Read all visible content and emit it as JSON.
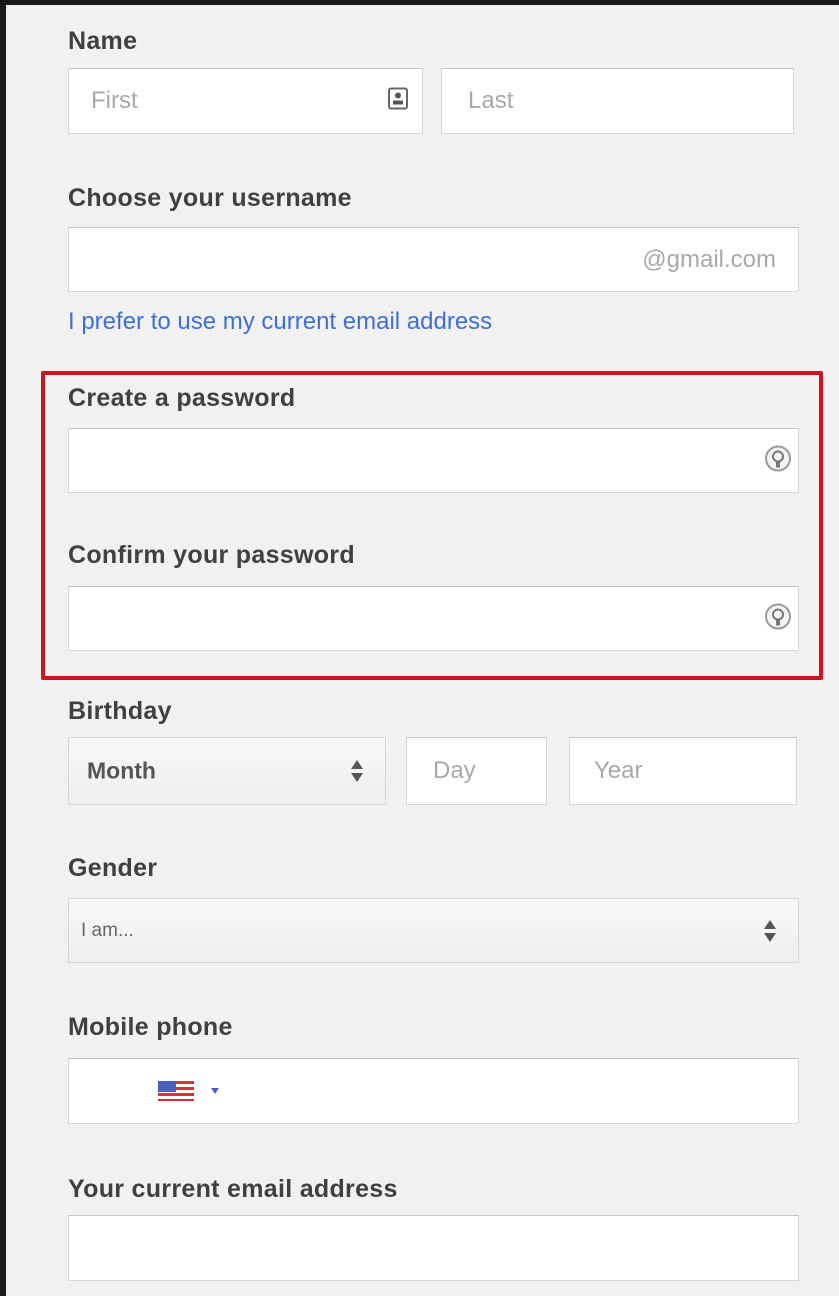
{
  "name": {
    "label": "Name",
    "first_placeholder": "First",
    "last_placeholder": "Last"
  },
  "username": {
    "label": "Choose your username",
    "suffix": "@gmail.com",
    "alt_link": "I prefer to use my current email address"
  },
  "password": {
    "create_label": "Create a password",
    "confirm_label": "Confirm your password"
  },
  "birthday": {
    "label": "Birthday",
    "month": "Month",
    "day_placeholder": "Day",
    "year_placeholder": "Year"
  },
  "gender": {
    "label": "Gender",
    "selected": "I am..."
  },
  "mobile": {
    "label": "Mobile phone",
    "country_flag": "us-flag-icon"
  },
  "current_email": {
    "label": "Your current email address"
  },
  "colors": {
    "highlight": "#c7161d",
    "link": "#3f6fd6",
    "label": "#404040",
    "background": "#f1f1f1"
  }
}
